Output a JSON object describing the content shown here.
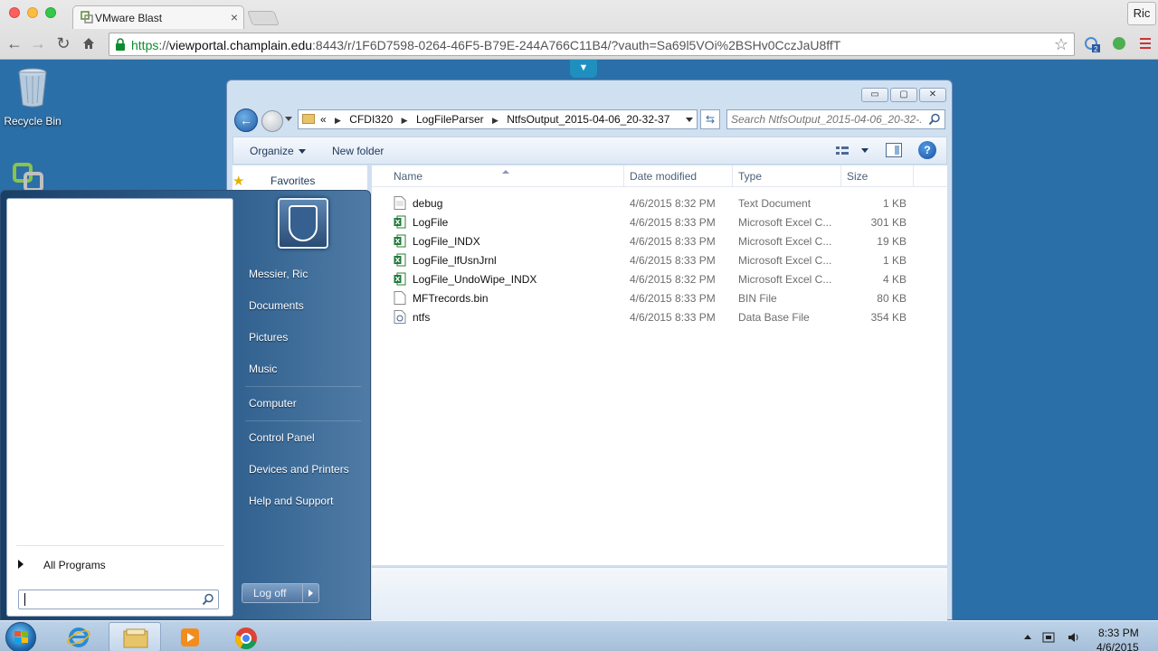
{
  "browser": {
    "tab_title": "VMware Blast",
    "tab_close": "×",
    "profile_name": "Ric",
    "url_scheme": "https",
    "url_sep": "://",
    "url_host": "viewportal.champlain.edu",
    "url_rest": ":8443/r/1F6D7598-0264-46F5-B79E-244A766C11B4/?vauth=Sa69l5VOi%2BSHv0CczJaU8ffT",
    "ext_badge": "2"
  },
  "desktop": {
    "recycle_bin_label": "Recycle Bin"
  },
  "explorer": {
    "window_buttons": {
      "minimize": "▭",
      "maximize": "▢",
      "close": "✕"
    },
    "breadcrumb": {
      "overflow": "«",
      "items": [
        "CFDI320",
        "LogFileParser",
        "NtfsOutput_2015-04-06_20-32-37"
      ]
    },
    "search_placeholder": "Search NtfsOutput_2015-04-06_20-32-...",
    "toolbar": {
      "organize": "Organize",
      "new_folder": "New folder",
      "help": "?"
    },
    "nav": {
      "favorites": "Favorites"
    },
    "columns": {
      "name": "Name",
      "date": "Date modified",
      "type": "Type",
      "size": "Size"
    },
    "files": [
      {
        "name": "debug",
        "date": "4/6/2015 8:32 PM",
        "type": "Text Document",
        "size": "1 KB",
        "icon": "text-file-icon"
      },
      {
        "name": "LogFile",
        "date": "4/6/2015 8:33 PM",
        "type": "Microsoft Excel C...",
        "size": "301 KB",
        "icon": "excel-icon"
      },
      {
        "name": "LogFile_INDX",
        "date": "4/6/2015 8:33 PM",
        "type": "Microsoft Excel C...",
        "size": "19 KB",
        "icon": "excel-icon"
      },
      {
        "name": "LogFile_lfUsnJrnl",
        "date": "4/6/2015 8:33 PM",
        "type": "Microsoft Excel C...",
        "size": "1 KB",
        "icon": "excel-icon"
      },
      {
        "name": "LogFile_UndoWipe_INDX",
        "date": "4/6/2015 8:32 PM",
        "type": "Microsoft Excel C...",
        "size": "4 KB",
        "icon": "excel-icon"
      },
      {
        "name": "MFTrecords.bin",
        "date": "4/6/2015 8:33 PM",
        "type": "BIN File",
        "size": "80 KB",
        "icon": "blank-file-icon"
      },
      {
        "name": "ntfs",
        "date": "4/6/2015 8:33 PM",
        "type": "Data Base File",
        "size": "354 KB",
        "icon": "database-file-icon"
      }
    ]
  },
  "start_menu": {
    "user_name": "Messier, Ric",
    "items": [
      "Documents",
      "Pictures",
      "Music",
      "Computer",
      "Control Panel",
      "Devices and Printers",
      "Help and Support"
    ],
    "all_programs": "All Programs",
    "log_off": "Log off"
  },
  "taskbar": {
    "time": "8:33 PM",
    "date": "4/6/2015"
  },
  "colors": {
    "desktop_bg": "#2b6fa8",
    "url_https": "#0b8c2f",
    "excel_green": "#1f7a3a"
  }
}
